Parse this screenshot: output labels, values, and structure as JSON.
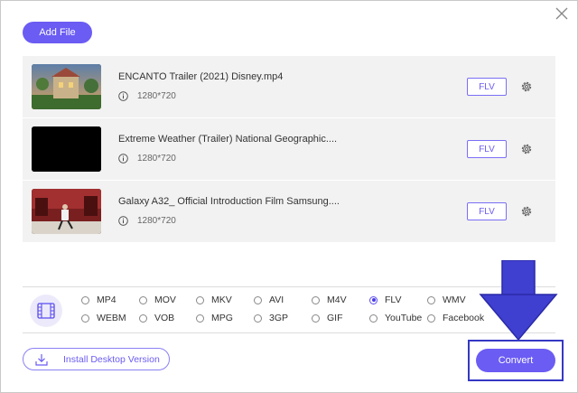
{
  "header": {
    "add_file_label": "Add File"
  },
  "files": [
    {
      "title": "ENCANTO Trailer (2021) Disney.mp4",
      "resolution": "1280*720",
      "format": "FLV"
    },
    {
      "title": "Extreme Weather (Trailer) National Geographic....",
      "resolution": "1280*720",
      "format": "FLV"
    },
    {
      "title": "Galaxy A32_ Official Introduction Film Samsung....",
      "resolution": "1280*720",
      "format": "FLV"
    }
  ],
  "formats": {
    "selected": "FLV",
    "options": [
      "MP4",
      "MOV",
      "MKV",
      "AVI",
      "M4V",
      "FLV",
      "WMV",
      "WEBM",
      "VOB",
      "MPG",
      "3GP",
      "GIF",
      "YouTube",
      "Facebook"
    ]
  },
  "footer": {
    "install_label": "Install Desktop Version",
    "convert_label": "Convert"
  },
  "colors": {
    "accent": "#6b5cf3",
    "arrow": "#3f3fd0",
    "highlight_border": "#3538c4",
    "row_bg": "#f2f2f2"
  },
  "icons": [
    "close-icon",
    "info-icon",
    "gear-icon",
    "film-icon",
    "download-icon",
    "arrow-down-icon"
  ]
}
